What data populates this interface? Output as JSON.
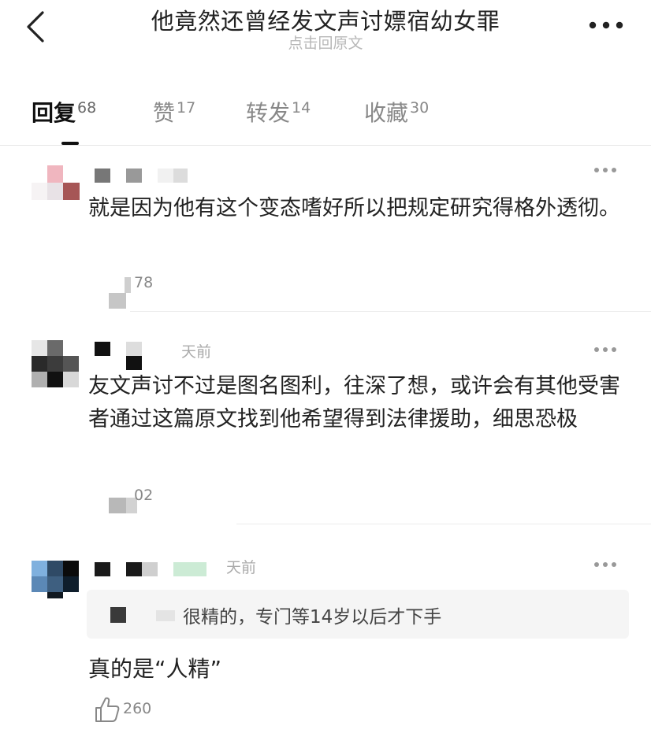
{
  "header": {
    "title": "他竟然还曾经发文声讨嫖宿幼女罪",
    "subtitle": "点击回原文",
    "back_icon": "chevron-left-icon",
    "more_icon": "more-horizontal-icon"
  },
  "tabs": [
    {
      "label": "回复",
      "count": "68",
      "active": true
    },
    {
      "label": "赞",
      "count": "17",
      "active": false
    },
    {
      "label": "转发",
      "count": "14",
      "active": false
    },
    {
      "label": "收藏",
      "count": "30",
      "active": false
    }
  ],
  "comments": [
    {
      "text": "就是因为他有这个变态嗜好所以把规定研究得格外透彻。",
      "likes": "78"
    },
    {
      "time": "天前",
      "text": "友文声讨不过是图名图利，往深了想，或许会有其他受害者通过这篇原文找到他希望得到法律援助，细思恐极",
      "likes": "02"
    },
    {
      "time": "天前",
      "quote": "很精的，专门等14岁以后才下手",
      "text": "真的是“人精”",
      "likes": "260",
      "like_icon": "thumbs-up-icon"
    }
  ],
  "colors": {
    "text": "#222222",
    "muted": "#aaaaaa",
    "divider": "#ececec",
    "quote_bg": "#f5f5f5"
  }
}
